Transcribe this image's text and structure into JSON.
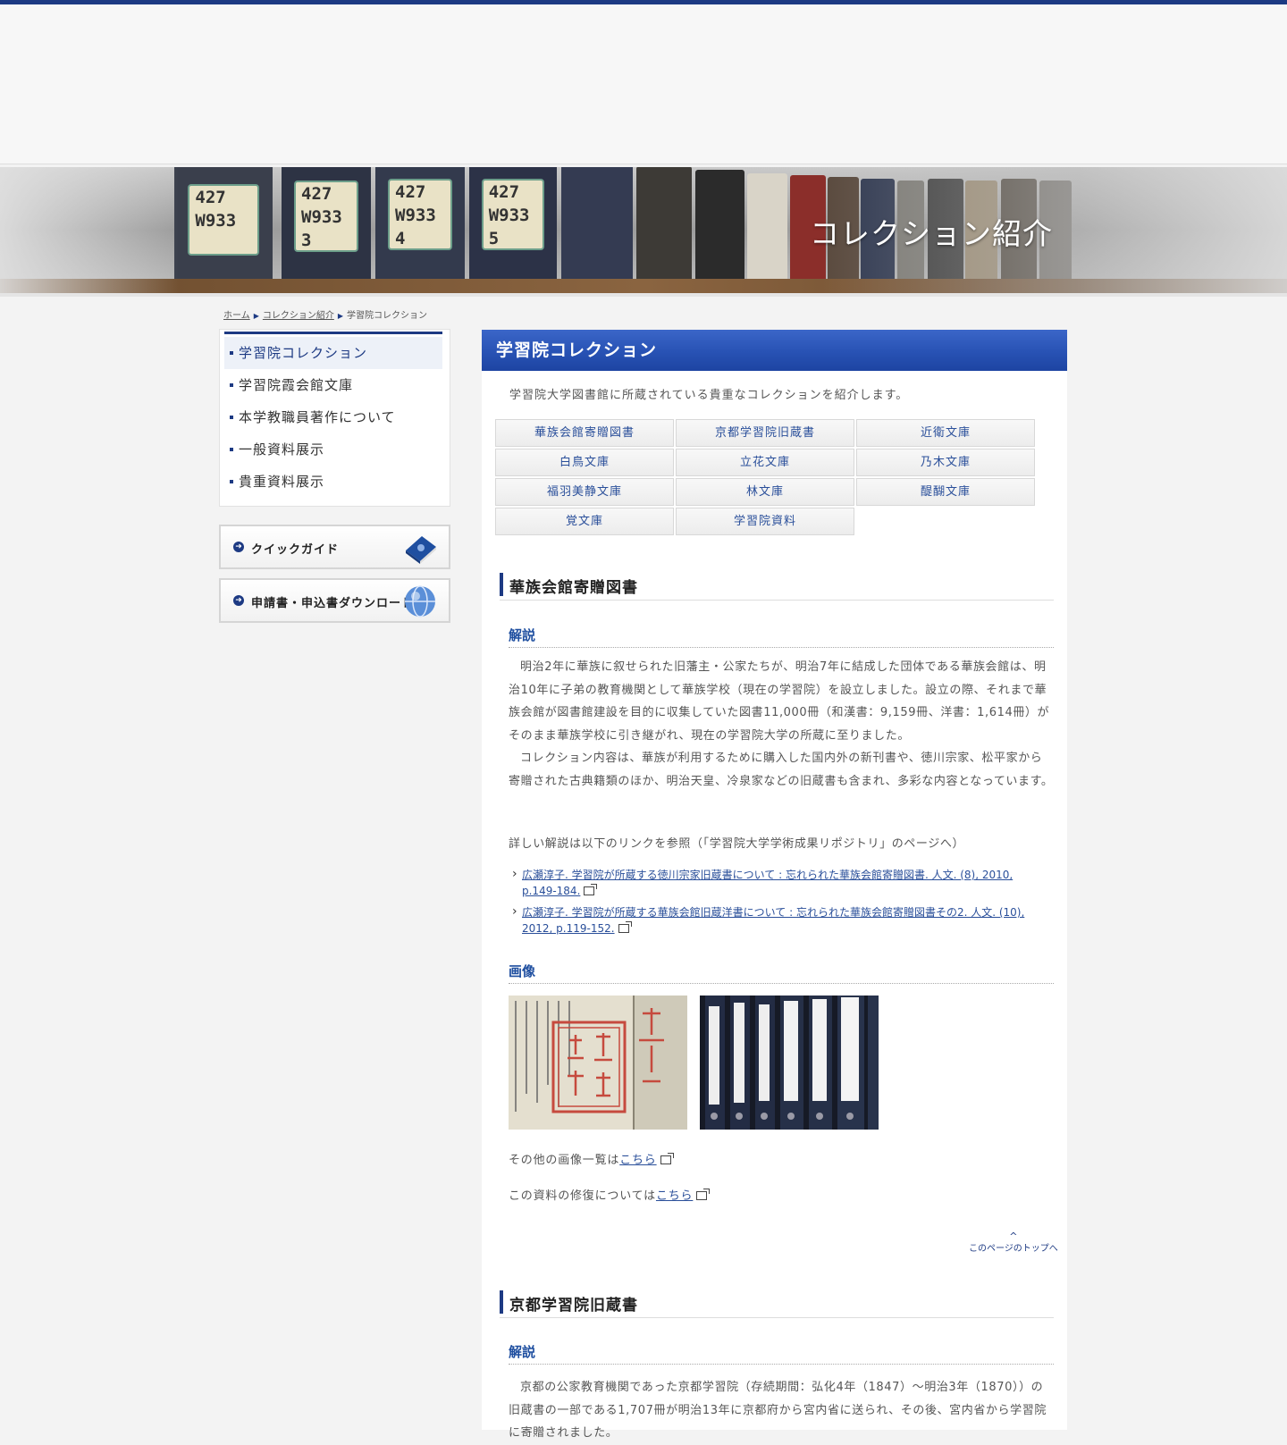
{
  "banner": {
    "title": "コレクション紹介"
  },
  "breadcrumb": {
    "home": "ホーム",
    "collection": "コレクション紹介",
    "current": "学習院コレクション"
  },
  "sidebar": {
    "items": [
      {
        "label": "学習院コレクション"
      },
      {
        "label": "学習院霞会館文庫"
      },
      {
        "label": "本学教職員著作について"
      },
      {
        "label": "一般資料展示"
      },
      {
        "label": "貴重資料展示"
      }
    ],
    "quick_guide": "クイックガイド",
    "download": "申請書・申込書ダウンロード"
  },
  "main": {
    "title": "学習院コレクション",
    "intro": "学習院大学図書館に所蔵されている貴重なコレクションを紹介します。",
    "collections": [
      "華族会館寄贈図書",
      "京都学習院旧蔵書",
      "近衛文庫",
      "白鳥文庫",
      "立花文庫",
      "乃木文庫",
      "福羽美静文庫",
      "林文庫",
      "醍醐文庫",
      "覚文庫",
      "学習院資料"
    ]
  },
  "section1": {
    "title": "華族会館寄贈図書",
    "sub_commentary": "解説",
    "para1": "明治2年に華族に叙せられた旧藩主・公家たちが、明治7年に結成した団体である華族会館は、明治10年に子弟の教育機関として華族学校（現在の学習院）を設立しました。設立の際、それまで華族会館が図書館建設を目的に収集していた図書11,000冊（和漢書：9,159冊、洋書：1,614冊）がそのまま華族学校に引き継がれ、現在の学習院大学の所蔵に至りました。",
    "para2": "コレクション内容は、華族が利用するために購入した国内外の新刊書や、徳川宗家、松平家から寄贈された古典籍類のほか、明治天皇、冷泉家などの旧蔵書も含まれ、多彩な内容となっています。",
    "refs_intro": "詳しい解説は以下のリンクを参照（「学習院大学学術成果リポジトリ」のページへ）",
    "ref1": "広瀬淳子. 学習院が所蔵する徳川宗家旧蔵書について : 忘れられた華族会館寄贈図書. 人文. (8), 2010, p.149-184.",
    "ref2": "広瀬淳子. 学習院が所蔵する華族会館旧蔵洋書について : 忘れられた華族会館寄贈図書その2. 人文. (10), 2012, p.119-152.",
    "sub_images": "画像",
    "other_images_prefix": "その他の画像一覧は",
    "other_images_link": "こちら",
    "repair_prefix": "この資料の修復については",
    "repair_link": "こちら",
    "to_top": "このページのトップへ"
  },
  "section2": {
    "title": "京都学習院旧蔵書",
    "sub_commentary": "解説",
    "para1": "京都の公家教育機関であった京都学習院（存続期間：弘化4年（1847）〜明治3年（1870））の旧蔵書の一部である1,707冊が明治13年に京都府から宮内省に送られ、その後、宮内省から学習院に寄贈されました。"
  },
  "colors": {
    "primary": "#1d3a83",
    "link": "#2a4f9a",
    "header_blue": "#2852b4"
  }
}
